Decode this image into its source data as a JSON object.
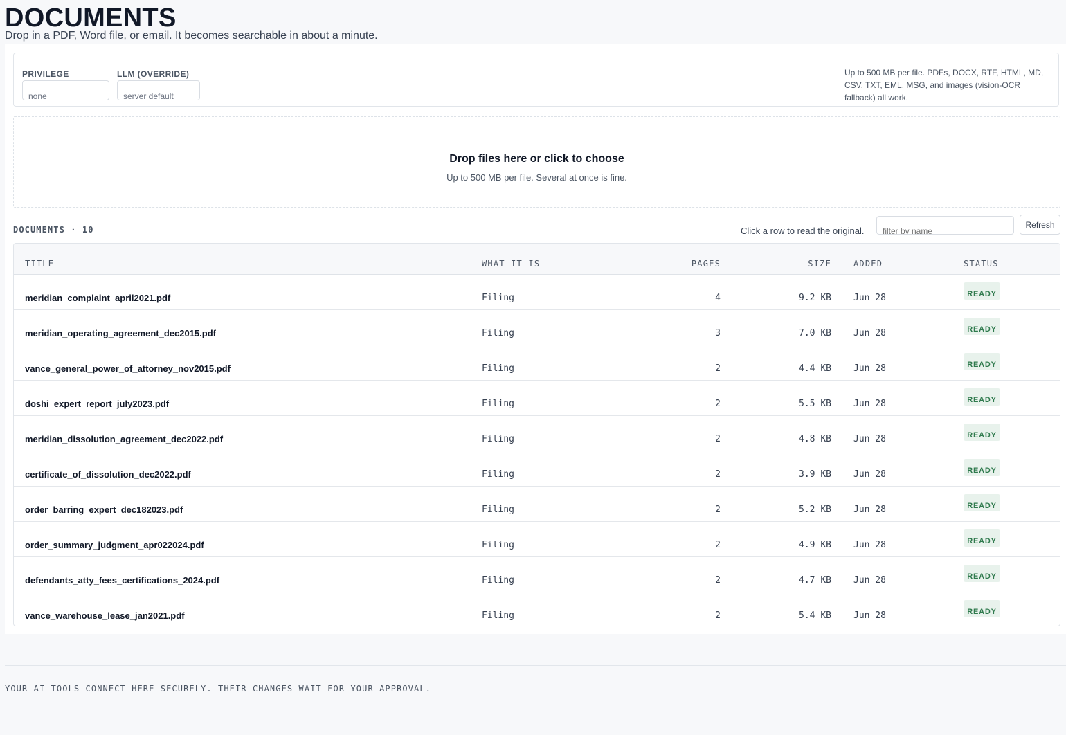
{
  "header": {
    "title": "DOCUMENTS",
    "subtitle": "Drop in a PDF, Word file, or email. It becomes searchable in about a minute."
  },
  "settings": {
    "privilege_label": "PRIVILEGE",
    "privilege_value": "none",
    "llm_label": "LLM (OVERRIDE)",
    "llm_value": "server default",
    "upload_hint": "Up to 500 MB per file. PDFs, DOCX, RTF, HTML, MD, CSV, TXT, EML, MSG, and images (vision-OCR fallback) all work."
  },
  "dropzone": {
    "title": "Drop files here or click to choose",
    "hint": "Up to 500 MB per file. Several at once is fine."
  },
  "documents": {
    "heading": "DOCUMENTS · 10",
    "row_help": "Click a row to read the original.",
    "filter_placeholder": "filter by name",
    "refresh_label": "Refresh",
    "columns": {
      "title": "TITLE",
      "kind": "WHAT IT IS",
      "pages": "PAGES",
      "size": "SIZE",
      "added": "ADDED",
      "status": "STATUS"
    },
    "rows": [
      {
        "title": "meridian_complaint_april2021.pdf",
        "kind": "Filing",
        "pages": "4",
        "size": "9.2 KB",
        "added": "Jun 28",
        "status": "READY"
      },
      {
        "title": "meridian_operating_agreement_dec2015.pdf",
        "kind": "Filing",
        "pages": "3",
        "size": "7.0 KB",
        "added": "Jun 28",
        "status": "READY"
      },
      {
        "title": "vance_general_power_of_attorney_nov2015.pdf",
        "kind": "Filing",
        "pages": "2",
        "size": "4.4 KB",
        "added": "Jun 28",
        "status": "READY"
      },
      {
        "title": "doshi_expert_report_july2023.pdf",
        "kind": "Filing",
        "pages": "2",
        "size": "5.5 KB",
        "added": "Jun 28",
        "status": "READY"
      },
      {
        "title": "meridian_dissolution_agreement_dec2022.pdf",
        "kind": "Filing",
        "pages": "2",
        "size": "4.8 KB",
        "added": "Jun 28",
        "status": "READY"
      },
      {
        "title": "certificate_of_dissolution_dec2022.pdf",
        "kind": "Filing",
        "pages": "2",
        "size": "3.9 KB",
        "added": "Jun 28",
        "status": "READY"
      },
      {
        "title": "order_barring_expert_dec182023.pdf",
        "kind": "Filing",
        "pages": "2",
        "size": "5.2 KB",
        "added": "Jun 28",
        "status": "READY"
      },
      {
        "title": "order_summary_judgment_apr022024.pdf",
        "kind": "Filing",
        "pages": "2",
        "size": "4.9 KB",
        "added": "Jun 28",
        "status": "READY"
      },
      {
        "title": "defendants_atty_fees_certifications_2024.pdf",
        "kind": "Filing",
        "pages": "2",
        "size": "4.7 KB",
        "added": "Jun 28",
        "status": "READY"
      },
      {
        "title": "vance_warehouse_lease_jan2021.pdf",
        "kind": "Filing",
        "pages": "2",
        "size": "5.4 KB",
        "added": "Jun 28",
        "status": "READY"
      }
    ]
  },
  "footer": {
    "text": "YOUR AI TOOLS CONNECT HERE SECURELY. THEIR CHANGES WAIT FOR YOUR APPROVAL."
  },
  "colors": {
    "background": "#f7f8fa",
    "surface": "#ffffff",
    "border": "#e1e5ea",
    "text": "#111827",
    "muted": "#4b5563",
    "ready_badge_bg": "#e8f2ec",
    "ready_badge_text": "#2f7a4d"
  }
}
